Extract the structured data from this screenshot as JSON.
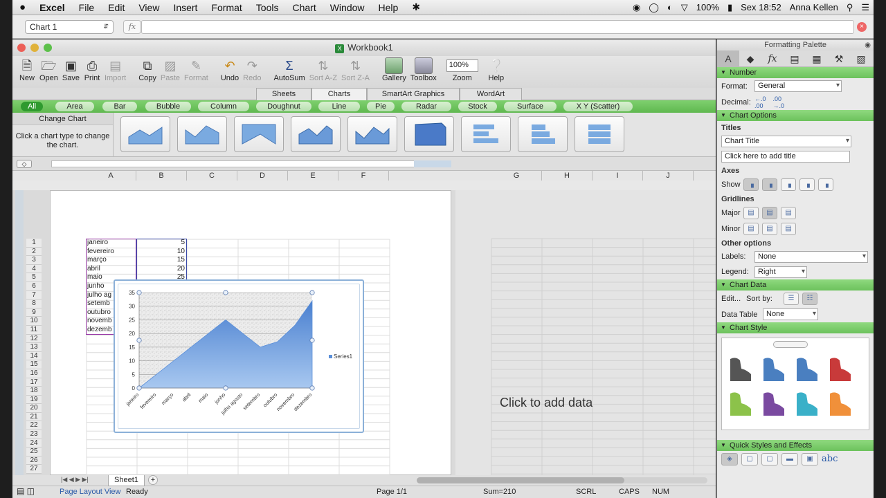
{
  "menubar": {
    "apple": "",
    "app": "Excel",
    "menus": [
      "File",
      "Edit",
      "View",
      "Insert",
      "Format",
      "Tools",
      "Chart",
      "Window",
      "Help"
    ],
    "battery": "100%",
    "clock": "Sex 18:52",
    "user": "Anna Kellen"
  },
  "namebar": {
    "name": "Chart 1",
    "fx": "fx"
  },
  "window": {
    "title": "Workbook1"
  },
  "toolbar": {
    "new": "New",
    "open": "Open",
    "save": "Save",
    "print": "Print",
    "import": "Import",
    "copy": "Copy",
    "paste": "Paste",
    "format": "Format",
    "undo": "Undo",
    "redo": "Redo",
    "autosum": "AutoSum",
    "sort_az": "Sort A-Z",
    "sort_za": "Sort Z-A",
    "gallery": "Gallery",
    "toolbox": "Toolbox",
    "zoom_value": "100%",
    "zoom": "Zoom",
    "help": "Help"
  },
  "ribbon_tabs": [
    "Sheets",
    "Charts",
    "SmartArt Graphics",
    "WordArt"
  ],
  "chart_types": [
    "All",
    "Area",
    "Bar",
    "Bubble",
    "Column",
    "Doughnut",
    "Line",
    "Pie",
    "Radar",
    "Stock",
    "Surface",
    "X Y (Scatter)"
  ],
  "gallery": {
    "heading": "Change Chart",
    "hint": "Click a chart type to change the chart."
  },
  "columns": [
    "A",
    "B",
    "C",
    "D",
    "E",
    "F",
    "G",
    "H",
    "I",
    "J"
  ],
  "rows": [
    "1",
    "2",
    "3",
    "4",
    "5",
    "6",
    "7",
    "8",
    "9",
    "10",
    "11",
    "12",
    "13",
    "14",
    "15",
    "16",
    "17",
    "18",
    "19",
    "20",
    "21",
    "22",
    "23",
    "24",
    "25",
    "26",
    "27"
  ],
  "cells": {
    "a": [
      "janeiro",
      "fevereiro",
      "março",
      "abril",
      "maio",
      "junho",
      "julho ag",
      "setemb",
      "outubro",
      "novemb",
      "dezemb"
    ],
    "b": [
      "5",
      "10",
      "15",
      "20",
      "25"
    ]
  },
  "chart_data": {
    "type": "area",
    "categories": [
      "janeiro",
      "fevereiro",
      "março",
      "abril",
      "maio",
      "junho",
      "julho agosto",
      "setembro",
      "outubro",
      "novembro",
      "dezembro"
    ],
    "series": [
      {
        "name": "Series1",
        "values": [
          0,
          5,
          10,
          15,
          20,
          25,
          20,
          15,
          17,
          23,
          32
        ]
      }
    ],
    "ylim": [
      0,
      35
    ],
    "yticks": [
      "0",
      "5",
      "10",
      "15",
      "20",
      "25",
      "30",
      "35"
    ],
    "legend": "right",
    "grid": true,
    "fill_color": "#5b8fd8"
  },
  "click_to_add": "Click to add data",
  "status": {
    "sheet_tab": "Sheet1",
    "view": "Page Layout View",
    "ready": "Ready",
    "page": "Page 1/1",
    "sum": "Sum=210",
    "scrl": "SCRL",
    "caps": "CAPS",
    "num": "NUM"
  },
  "palette": {
    "title": "Formatting Palette",
    "number": "Number",
    "format_label": "Format:",
    "format_value": "General",
    "decimal_label": "Decimal:",
    "chart_options": "Chart Options",
    "titles": "Titles",
    "title_select": "Chart Title",
    "title_input": "Click here to add title",
    "axes": "Axes",
    "show": "Show",
    "gridlines": "Gridlines",
    "major": "Major",
    "minor": "Minor",
    "other_options": "Other options",
    "labels_label": "Labels:",
    "labels_value": "None",
    "legend_label": "Legend:",
    "legend_value": "Right",
    "chart_data_sec": "Chart Data",
    "edit": "Edit...",
    "sort_by": "Sort by:",
    "data_table_label": "Data Table",
    "data_table_value": "None",
    "chart_style": "Chart Style",
    "style_colors": [
      "#555555",
      "#4a7fc0",
      "#4a7fc0",
      "#c83a3a",
      "#8cc24a",
      "#7a4aa0",
      "#3ab0c8",
      "#f0903a"
    ],
    "quick_styles": "Quick Styles and Effects",
    "abc": "abc"
  }
}
